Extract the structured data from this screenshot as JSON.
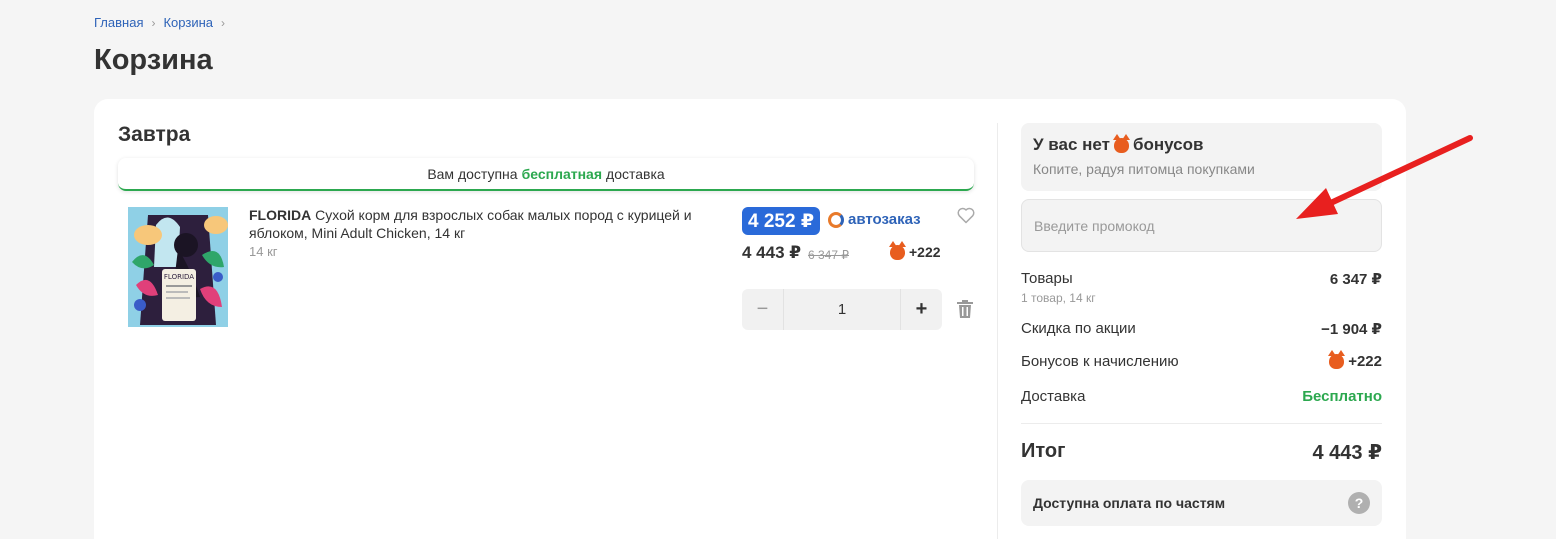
{
  "breadcrumb": {
    "home": "Главная",
    "cart": "Корзина"
  },
  "page_title": "Корзина",
  "cart": {
    "section_title": "Завтра",
    "banner": {
      "prefix": "Вам доступна",
      "highlight": "бесплатная",
      "suffix": "доставка"
    },
    "item": {
      "brand": "FLORIDA",
      "name": "Сухой корм для взрослых собак малых пород с курицей и яблоком, Mini Adult Chicken, 14 кг",
      "weight": "14 кг",
      "price_autoorder": "4 252 ₽",
      "autoorder_label": "автозаказ",
      "price": "4 443 ₽",
      "price_old": "6 347 ₽",
      "bonus": "+222",
      "quantity": "1",
      "minus": "−",
      "plus": "+"
    }
  },
  "summary": {
    "bonus_title_prefix": "У вас нет",
    "bonus_title_suffix": "бонусов",
    "bonus_sub": "Копите, радуя питомца покупками",
    "promo_placeholder": "Введите промокод",
    "goods_label": "Товары",
    "goods_value": "6 347 ₽",
    "goods_sub": "1 товар, 14 кг",
    "discount_label": "Скидка по акции",
    "discount_value": "−1 904 ₽",
    "bonus_label": "Бонусов к начислению",
    "bonus_value": "+222",
    "delivery_label": "Доставка",
    "delivery_value": "Бесплатно",
    "total_label": "Итог",
    "total_value": "4 443 ₽",
    "installments_label": "Доступна оплата по частям",
    "help_icon": "?"
  },
  "colors": {
    "accent": "#2a6ad9",
    "green": "#2ca84f",
    "bonus": "#e85d1f",
    "arrow": "#e8201f"
  }
}
